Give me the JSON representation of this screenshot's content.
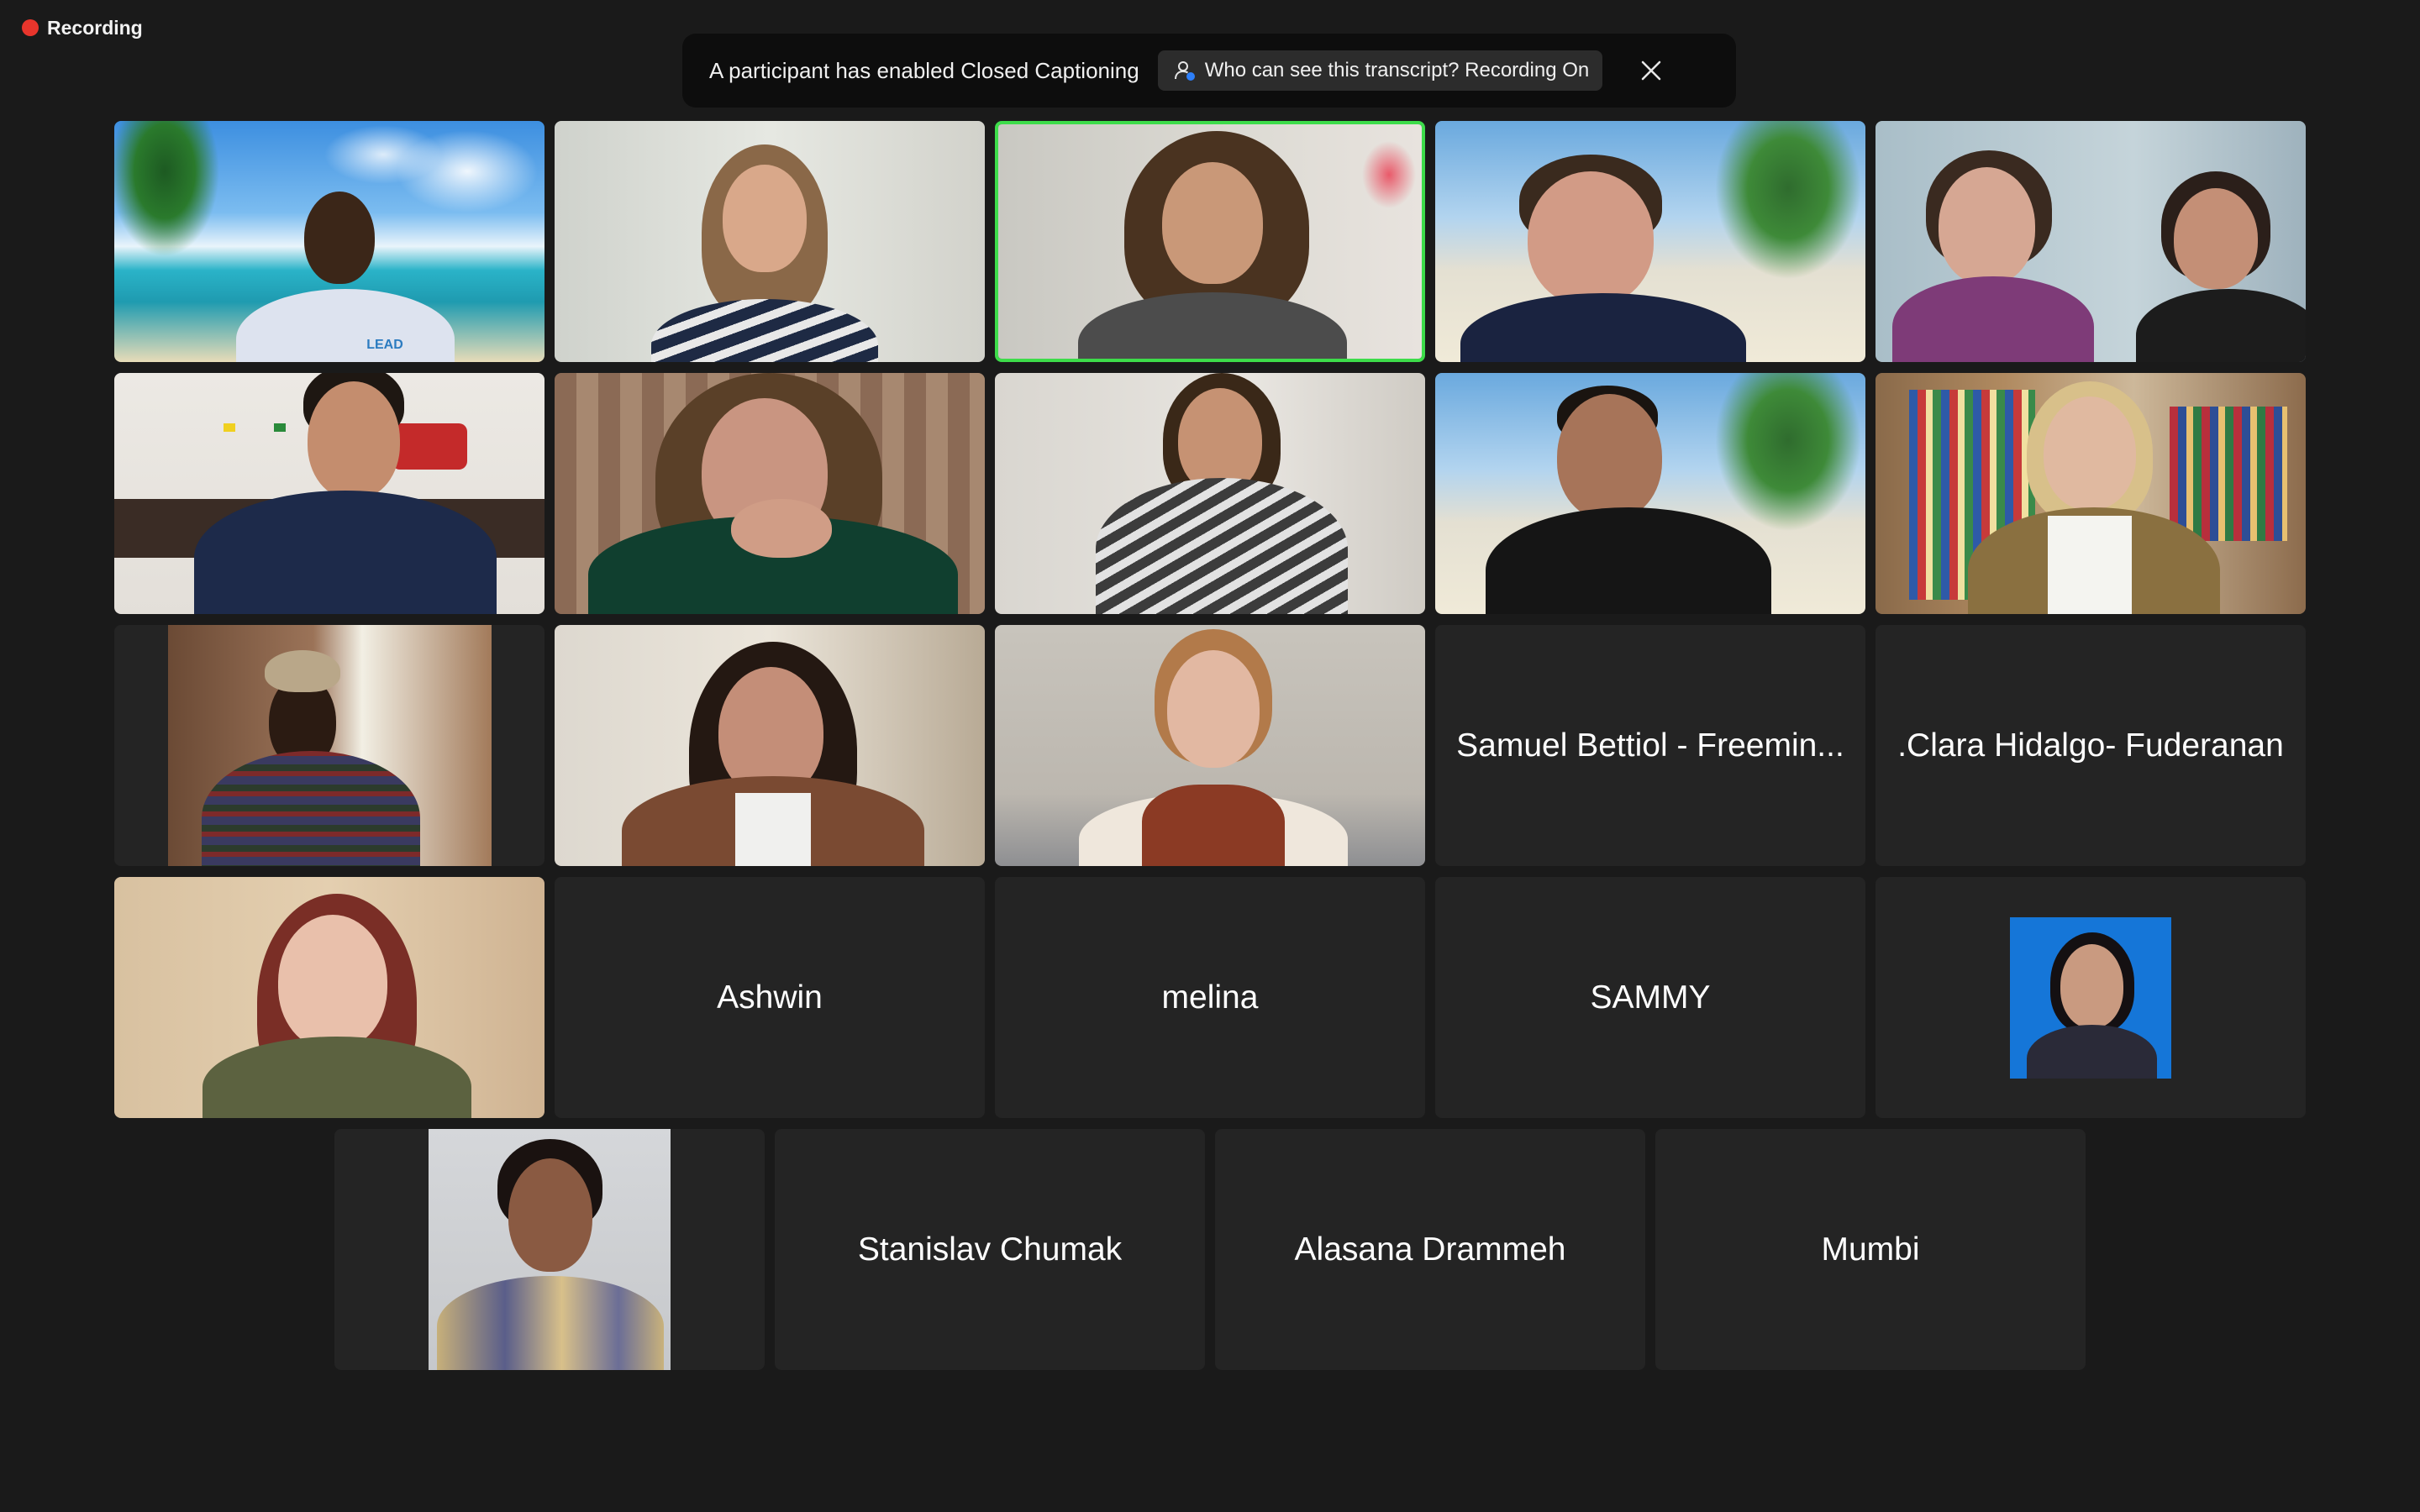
{
  "recording": {
    "label": "Recording",
    "color": "#e8352c"
  },
  "banner": {
    "text": "A participant has enabled Closed Captioning",
    "transcript_button": "Who can see this transcript? Recording On",
    "close_icon": "close-icon"
  },
  "participants": {
    "name_tiles": [
      "Samuel Bettiol - Freemin...",
      ".Clara Hidalgo- Fuderanan",
      "Ashwin",
      "melina",
      "SAMMY",
      "Stanislav Chumak",
      "Alasana Drammeh",
      "Mumbi"
    ],
    "logo_text": "LEAD"
  },
  "colors": {
    "background": "#1a1a1a",
    "tile": "#242424",
    "active_speaker_border": "#3ddc4a"
  }
}
